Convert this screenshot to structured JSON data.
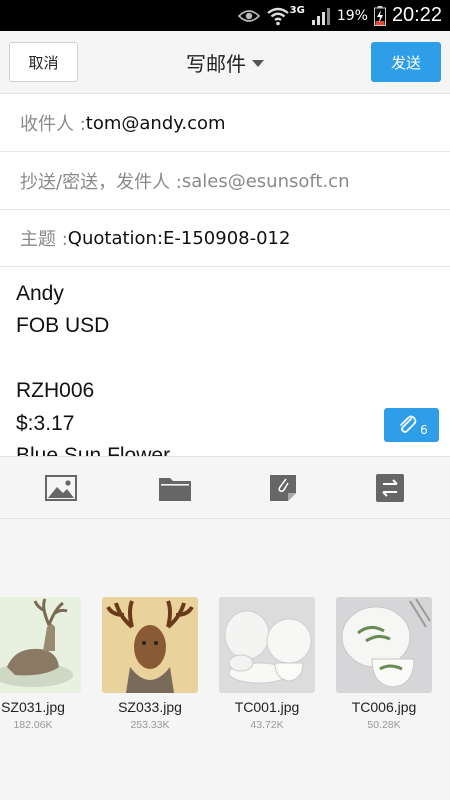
{
  "status_bar": {
    "battery_percent": "19%",
    "network": "3G",
    "time": "20:22"
  },
  "header": {
    "cancel_label": "取消",
    "title": "写邮件",
    "send_label": "发送"
  },
  "form": {
    "to_label": "收件人 : ",
    "to_value": "tom@andy.com",
    "cc_label": "抄送/密送，发件人 : ",
    "cc_value": "sales@esunsoft.cn",
    "subject_label": "主题 : ",
    "subject_value": "Quotation:E-150908-012"
  },
  "body_lines": [
    "Andy",
    "FOB USD",
    "",
    "RZH006",
    "$:3.17",
    "Blue Sun Flower"
  ],
  "attachment_badge": {
    "icon": "paperclip-icon",
    "count": "6"
  },
  "toolbar": {
    "icons": [
      "image-icon",
      "folder-icon",
      "note-icon",
      "swap-icon"
    ]
  },
  "attachments": [
    {
      "name": "SZ031.jpg",
      "size": "182.06K"
    },
    {
      "name": "SZ033.jpg",
      "size": "253.33K"
    },
    {
      "name": "TC001.jpg",
      "size": "43.72K"
    },
    {
      "name": "TC006.jpg",
      "size": "50.28K"
    }
  ],
  "colors": {
    "accent": "#2f9ee8",
    "status_bar": "#000000",
    "background": "#f5f5f5"
  }
}
